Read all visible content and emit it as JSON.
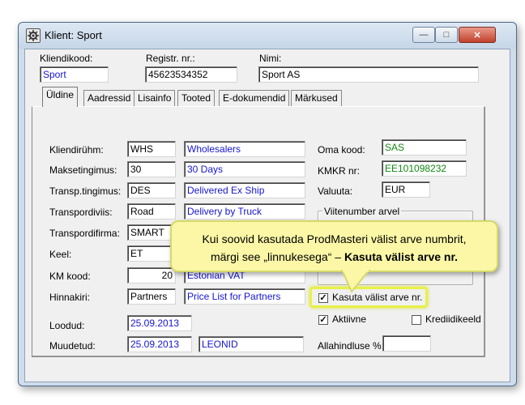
{
  "window": {
    "title": "Klient: Sport"
  },
  "header": {
    "kliendikood_label": "Kliendikood:",
    "kliendikood_value": "Sport",
    "regnr_label": "Registr. nr.:",
    "regnr_value": "45623534352",
    "nimi_label": "Nimi:",
    "nimi_value": "Sport AS"
  },
  "tabs": [
    "Üldine",
    "Aadressid",
    "Lisainfo",
    "Tooted",
    "E-dokumendid",
    "Märkused"
  ],
  "left": {
    "kliendigrupp": {
      "label": "Kliendirühm:",
      "code": "WHS",
      "name": "Wholesalers"
    },
    "maksetingimus": {
      "label": "Maksetingimus:",
      "code": "30",
      "name": "30 Days"
    },
    "transp_tingimus": {
      "label": "Transp.tingimus:",
      "code": "DES",
      "name": "Delivered Ex Ship"
    },
    "transpordiviis": {
      "label": "Transpordiviis:",
      "code": "Road",
      "name": "Delivery by Truck"
    },
    "transpordifirma": {
      "label": "Transpordifirma:",
      "code": "SMART"
    },
    "keel": {
      "label": "Keel:",
      "code": "ET"
    },
    "km_kood": {
      "label": "KM kood:",
      "code": "20",
      "name": "Estonian VAT"
    },
    "hinnakiri": {
      "label": "Hinnakiri:",
      "code": "Partners",
      "name": "Price List for Partners"
    },
    "loodud": {
      "label": "Loodud:",
      "date": "25.09.2013"
    },
    "muudetud": {
      "label": "Muudetud:",
      "date": "25.09.2013",
      "user": "LEONID"
    }
  },
  "right": {
    "oma_kood": {
      "label": "Oma kood:",
      "value": "SAS"
    },
    "kmkr": {
      "label": "KMKR nr:",
      "value": "EE101098232"
    },
    "valuuta": {
      "label": "Valuuta:",
      "value": "EUR"
    },
    "viitenumber_group": "Viitenumber arvel",
    "kasuta_valist": {
      "label": "Kasuta välist arve nr.",
      "checked": true
    },
    "aktiivne": {
      "label": "Aktiivne",
      "checked": true
    },
    "krediidikeeld": {
      "label": "Krediidikeeld",
      "checked": false
    },
    "allahindluse": {
      "label": "Allahindluse %:",
      "value": ""
    }
  },
  "callout": {
    "line1": "Kui soovid kasutada ProdMasteri välist arve numbrit,",
    "line2_pre": "märgi see „linnukesega“ – ",
    "line2_bold": "Kasuta välist arve nr."
  },
  "colors": {
    "link_blue": "#1515d0",
    "green_text": "#138813",
    "callout_bg": "#fbf7a6",
    "highlight": "#e8f047"
  }
}
